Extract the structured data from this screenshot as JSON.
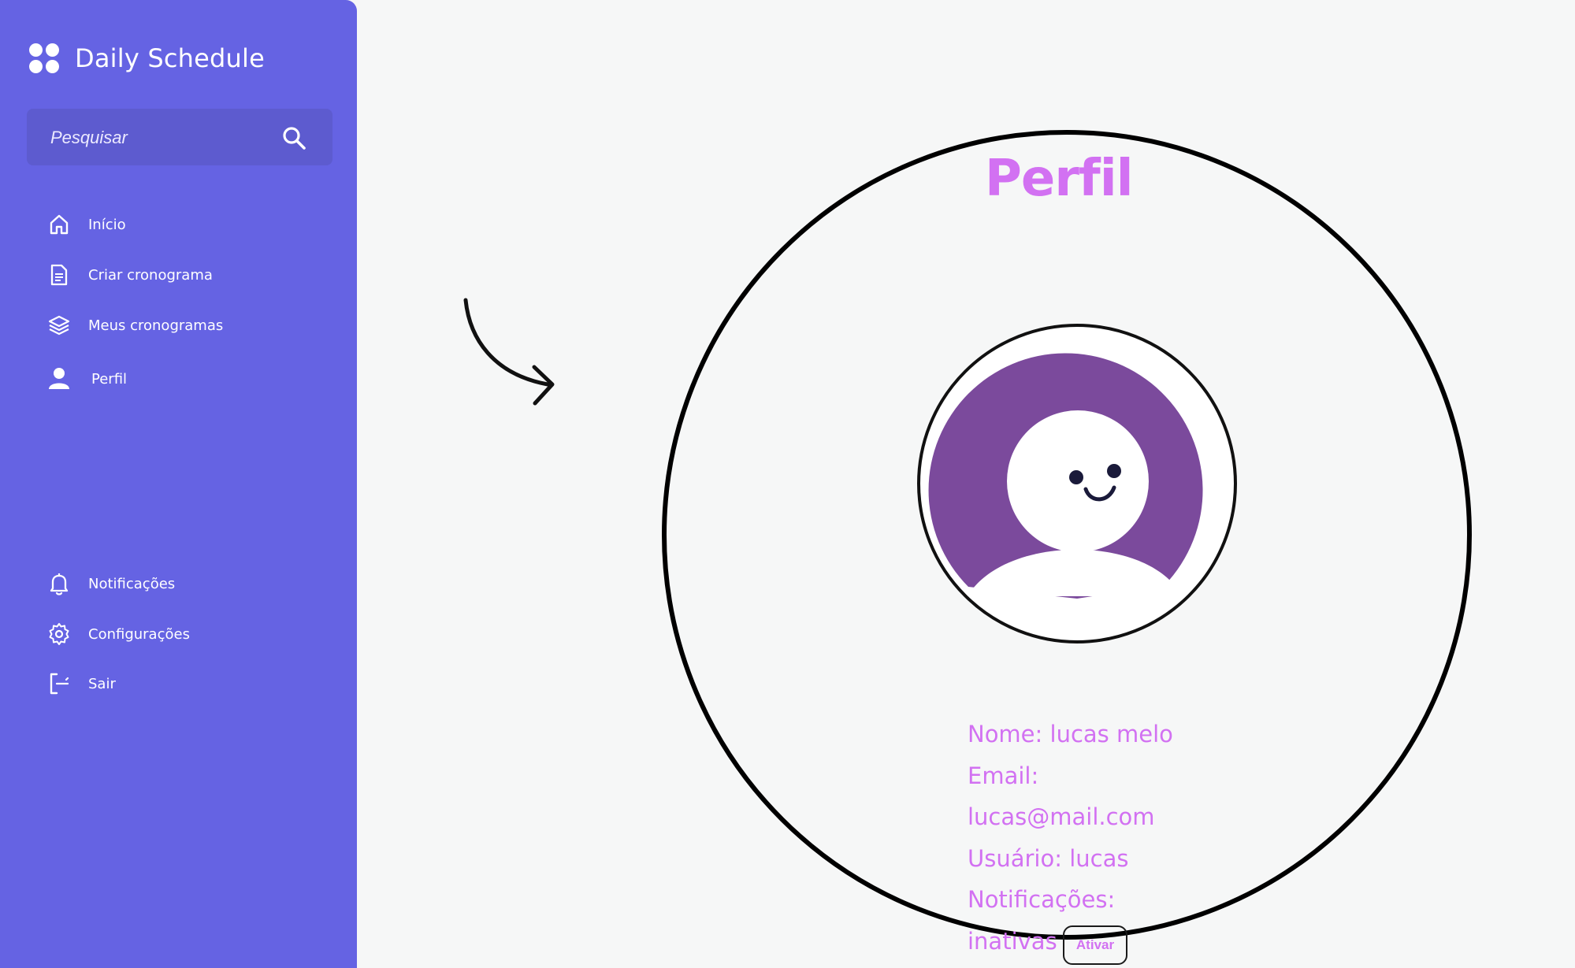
{
  "sidebar": {
    "brand": "Daily Schedule",
    "search_placeholder": "Pesquisar",
    "nav": [
      {
        "label": "Início",
        "icon": "home-icon"
      },
      {
        "label": "Criar cronograma",
        "icon": "document-icon"
      },
      {
        "label": "Meus cronogramas",
        "icon": "layers-icon"
      },
      {
        "label": "Perfil",
        "icon": "user-icon"
      }
    ],
    "bottom_nav": [
      {
        "label": "Notificações",
        "icon": "bell-icon"
      },
      {
        "label": "Configurações",
        "icon": "gear-icon"
      },
      {
        "label": "Sair",
        "icon": "logout-icon"
      }
    ]
  },
  "profile": {
    "title": "Perfil",
    "name_line": "Nome: lucas melo",
    "email_label": "Email:",
    "email_value": "lucas@mail.com",
    "user_line": "Usuário: lucas",
    "notifications_label": "Notificações:",
    "notifications_status": "inativas",
    "activate_button": "Ativar"
  },
  "colors": {
    "sidebar": "#6563e3",
    "search": "#5d5bcf",
    "accent": "#d271f2",
    "avatar_bg": "#7b4a9c",
    "background": "#f6f7f7"
  }
}
